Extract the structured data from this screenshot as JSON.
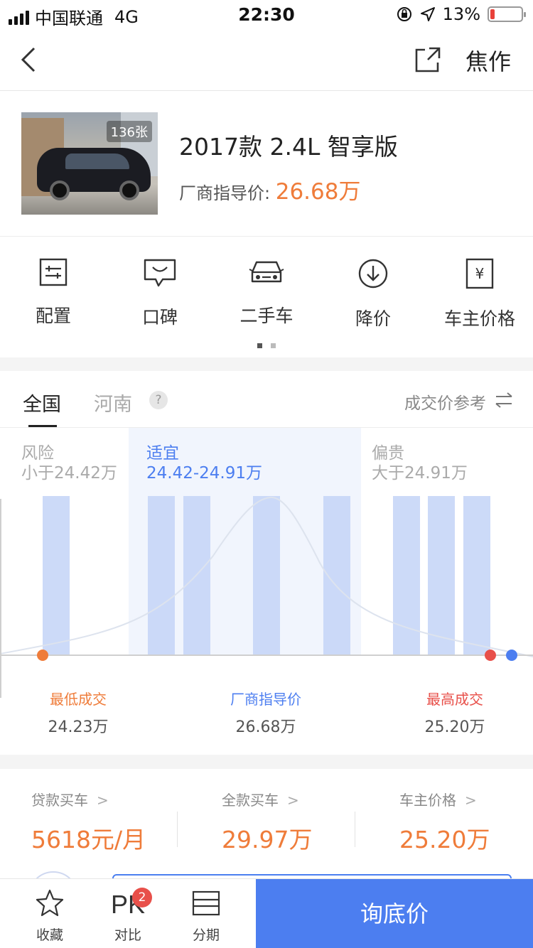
{
  "status_bar": {
    "carrier": "中国联通",
    "network": "4G",
    "time": "22:30",
    "battery": "13%",
    "battery_level": 0.13
  },
  "nav": {
    "title": "焦作",
    "back_icon": "chevron-left-icon",
    "share_icon": "share-icon"
  },
  "car": {
    "photo_count": "136张",
    "title": "2017款 2.4L 智享版",
    "price_label": "厂商指导价:",
    "price_value": "26.68万"
  },
  "functions": [
    {
      "label": "配置",
      "icon": "config-icon"
    },
    {
      "label": "口碑",
      "icon": "comment-icon"
    },
    {
      "label": "二手车",
      "icon": "used-car-icon"
    },
    {
      "label": "降价",
      "icon": "price-drop-icon"
    },
    {
      "label": "车主价格",
      "icon": "owner-price-icon"
    }
  ],
  "tabs": {
    "items": [
      "全国",
      "河南"
    ],
    "help": "?",
    "reference": "成交价参考"
  },
  "zones": {
    "risk": {
      "title": "风险",
      "range": "小于24.42万"
    },
    "fair": {
      "title": "适宜",
      "range": "24.42-24.91万"
    },
    "expensive": {
      "title": "偏贵",
      "range": "大于24.91万"
    }
  },
  "chart_data": {
    "type": "bar",
    "values": [
      1,
      1,
      1,
      1,
      1,
      1,
      1,
      1
    ],
    "colors": {
      "bar": "#c7d6f7",
      "fair_zone": "#f1f5fd",
      "low": "#ef7c3a",
      "high": "#e8504a",
      "guide": "#4c7ef0"
    }
  },
  "stats": {
    "min": {
      "label": "最低成交",
      "value": "24.23万"
    },
    "guide": {
      "label": "厂商指导价",
      "value": "26.68万"
    },
    "max": {
      "label": "最高成交",
      "value": "25.20万"
    }
  },
  "finance": [
    {
      "label": "贷款买车",
      "value": "5618元/月"
    },
    {
      "label": "全款买车",
      "value": "29.97万"
    },
    {
      "label": "车主价格",
      "value": "25.20万"
    }
  ],
  "bottom": {
    "favorite": "收藏",
    "compare_badge": "2",
    "compare_icon_text": "PK",
    "compare": "对比",
    "installment": "分期",
    "cta": "询底价"
  }
}
